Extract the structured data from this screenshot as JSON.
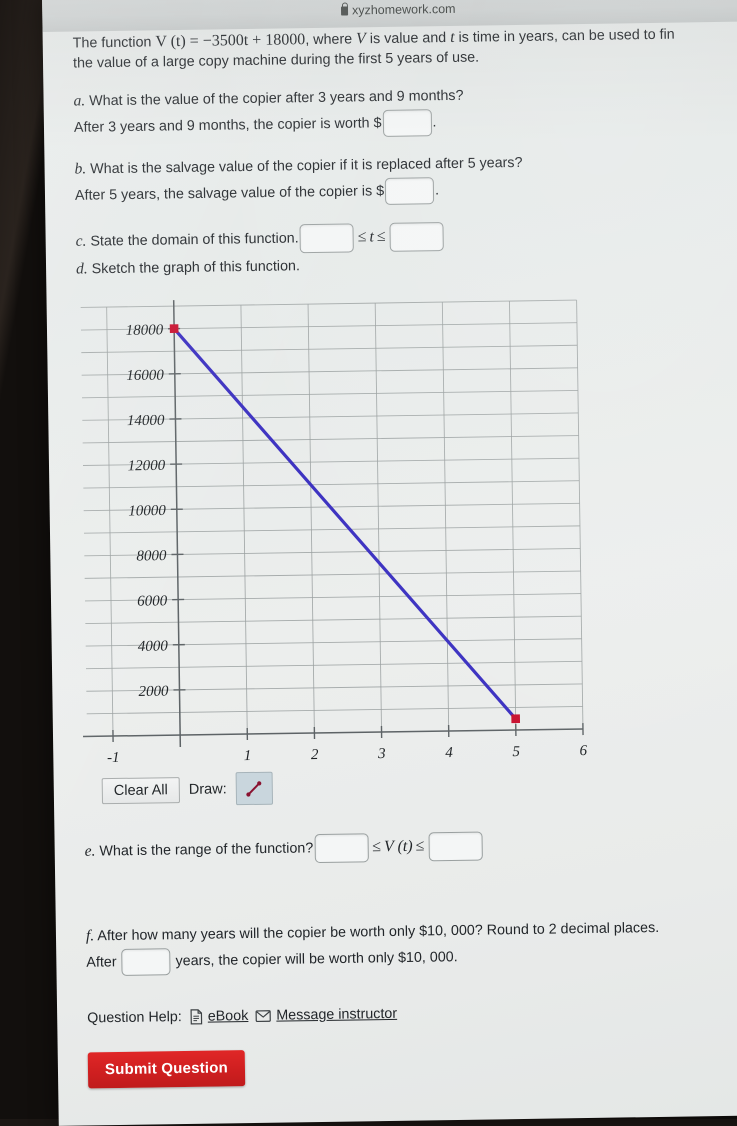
{
  "browser": {
    "menu_dots": "•••",
    "url": "xyzhomework.com",
    "lock_icon": "lock-icon"
  },
  "problem": {
    "intro_line1_pre": "The function ",
    "intro_formula": "V (t) = −3500t + 18000",
    "intro_line1_post": ", where ",
    "intro_v": "V",
    "intro_line1_mid": " is value and ",
    "intro_t": "t",
    "intro_line1_end": " is time in years, can be used to fin",
    "intro_line2": "the value of a large copy machine during the first 5 years of use."
  },
  "parts": {
    "a": {
      "label": "a.",
      "question": "What is the value of the copier after 3 years and 9 months?",
      "answer_prefix": "After 3 years and 9 months, the copier is worth $",
      "answer_value": "",
      "answer_suffix": "."
    },
    "b": {
      "label": "b.",
      "question": "What is the salvage value of the copier if it is replaced after 5 years?",
      "answer_prefix": "After 5 years, the salvage value of the copier is $",
      "answer_value": "",
      "answer_suffix": "."
    },
    "c": {
      "label": "c.",
      "question": "State the domain of this function.",
      "lower_value": "",
      "rel_left": "≤",
      "variable": "t",
      "rel_right": "≤",
      "upper_value": ""
    },
    "d": {
      "label": "d.",
      "question": "Sketch the graph of this function."
    },
    "e": {
      "label": "e.",
      "question": "What is the range of the function?",
      "lower_value": "",
      "rel_left": "≤",
      "variable": "V (t)",
      "rel_right": "≤",
      "upper_value": ""
    },
    "f": {
      "label": "f.",
      "question": "After how many years will the copier be worth only $10, 000? Round to 2 decimal places.",
      "answer_prefix": "After",
      "answer_value": "",
      "answer_suffix": "years, the copier will be worth only $10, 000."
    }
  },
  "graph_tools": {
    "clear_all_label": "Clear All",
    "draw_label": "Draw:",
    "draw_tool_icon": "line-segment-icon"
  },
  "help": {
    "label": "Question Help:",
    "ebook_label": "eBook",
    "ebook_icon": "document-icon",
    "message_label": "Message instructor",
    "message_icon": "envelope-icon"
  },
  "footer": {
    "submit_label": "Submit Question"
  },
  "colors": {
    "submit_red": "#cf1f20",
    "line_blue": "#3a2fc0",
    "point_red": "#c8102e",
    "grid": "#9aa0a0",
    "axis": "#5d6366"
  },
  "chart_data": {
    "type": "line",
    "title": "",
    "xlabel": "",
    "ylabel": "",
    "xlim": [
      -1,
      6
    ],
    "ylim": [
      0,
      19000
    ],
    "xticks": [
      -1,
      1,
      2,
      3,
      4,
      5,
      6
    ],
    "xtick_labels": [
      "-1",
      "1",
      "2",
      "3",
      "4",
      "5",
      "6"
    ],
    "yticks": [
      2000,
      4000,
      6000,
      8000,
      10000,
      12000,
      14000,
      16000,
      18000
    ],
    "ytick_labels": [
      "2000",
      "4000",
      "6000",
      "8000",
      "10000",
      "12000",
      "14000",
      "16000",
      "18000"
    ],
    "y_gridline_step": 1000,
    "x_gridline_step": 1,
    "grid": true,
    "legend": "none",
    "series": [
      {
        "name": "V(t) = -3500t + 18000",
        "color": "#3a2fc0",
        "x": [
          0,
          5
        ],
        "y": [
          18000,
          500
        ],
        "endpoints": [
          {
            "x": 0,
            "y": 18000,
            "style": "closed-square",
            "color": "#c8102e"
          },
          {
            "x": 5,
            "y": 500,
            "style": "closed-square",
            "color": "#c8102e"
          }
        ]
      }
    ]
  }
}
